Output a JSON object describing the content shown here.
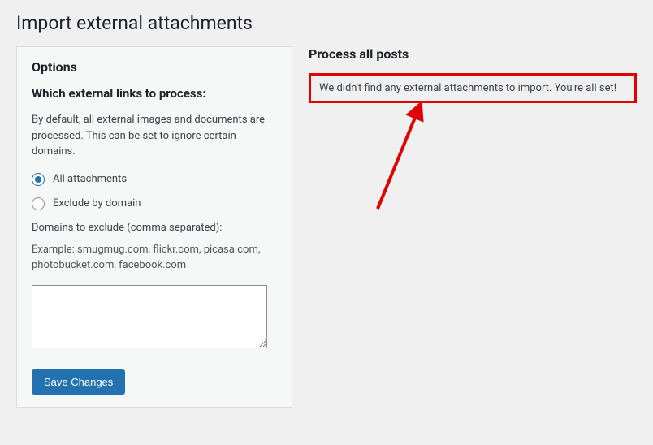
{
  "page_title": "Import external attachments",
  "options": {
    "heading": "Options",
    "subheading": "Which external links to process:",
    "description": "By default, all external images and documents are processed. This can be set to ignore certain domains.",
    "radio": {
      "all_label": "All attachments",
      "exclude_label": "Exclude by domain",
      "selected": "all"
    },
    "domains_label": "Domains to exclude (comma separated):",
    "domains_example": "Example: smugmug.com, flickr.com, picasa.com, photobucket.com, facebook.com",
    "domains_value": "",
    "save_button": "Save Changes"
  },
  "process": {
    "heading": "Process all posts",
    "message": "We didn't find any external attachments to import. You're all set!"
  },
  "annotation": {
    "color": "#e30000"
  }
}
